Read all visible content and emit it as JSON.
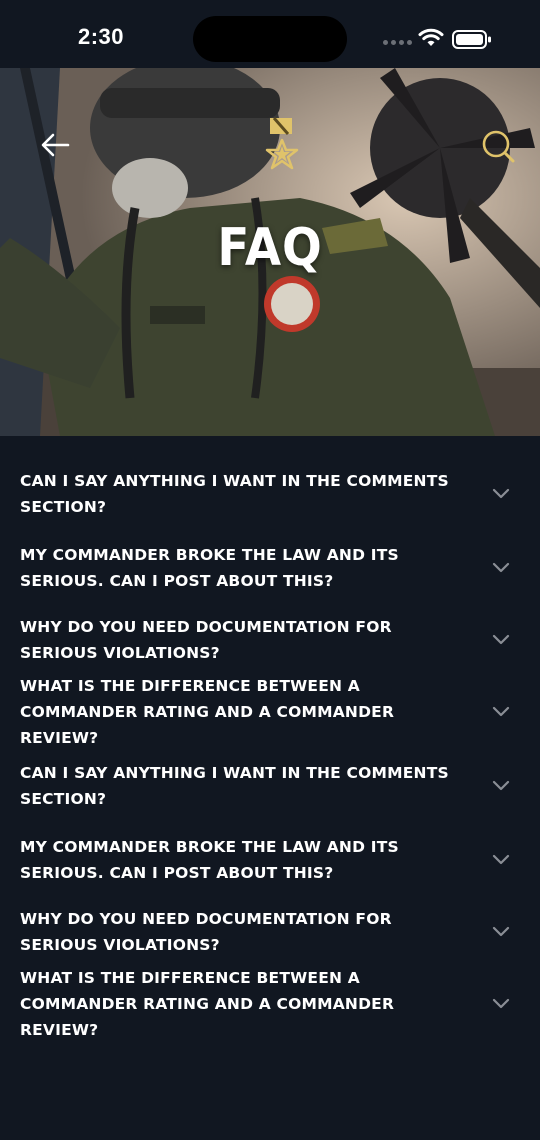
{
  "status_bar": {
    "time": "2:30"
  },
  "header": {
    "title": "FAQ",
    "back_icon": "arrow-left-icon",
    "search_icon": "search-icon"
  },
  "faq": {
    "items": [
      {
        "question": "CAN I SAY ANYTHING I WANT IN THE COMMENTS SECTION?"
      },
      {
        "question": "MY COMMANDER BROKE THE LAW AND ITS SERIOUS. CAN I POST ABOUT THIS?"
      },
      {
        "question": "WHY DO YOU NEED DOCUMENTATION FOR SERIOUS VIOLATIONS?"
      },
      {
        "question": "WHAT IS THE DIFFERENCE BETWEEN A COMMANDER RATING AND A COMMANDER REVIEW?"
      },
      {
        "question": "CAN I SAY ANYTHING I WANT IN THE COMMENTS SECTION?"
      },
      {
        "question": "MY COMMANDER BROKE THE LAW AND ITS SERIOUS. CAN I POST ABOUT THIS?"
      },
      {
        "question": "WHY DO YOU NEED DOCUMENTATION FOR SERIOUS VIOLATIONS?"
      },
      {
        "question": "WHAT IS THE DIFFERENCE BETWEEN A COMMANDER RATING AND A COMMANDER REVIEW?"
      }
    ]
  },
  "colors": {
    "background": "#111721",
    "text": "#ffffff",
    "chevron": "#8a8e95",
    "accent_gold": "#e0c36a"
  }
}
